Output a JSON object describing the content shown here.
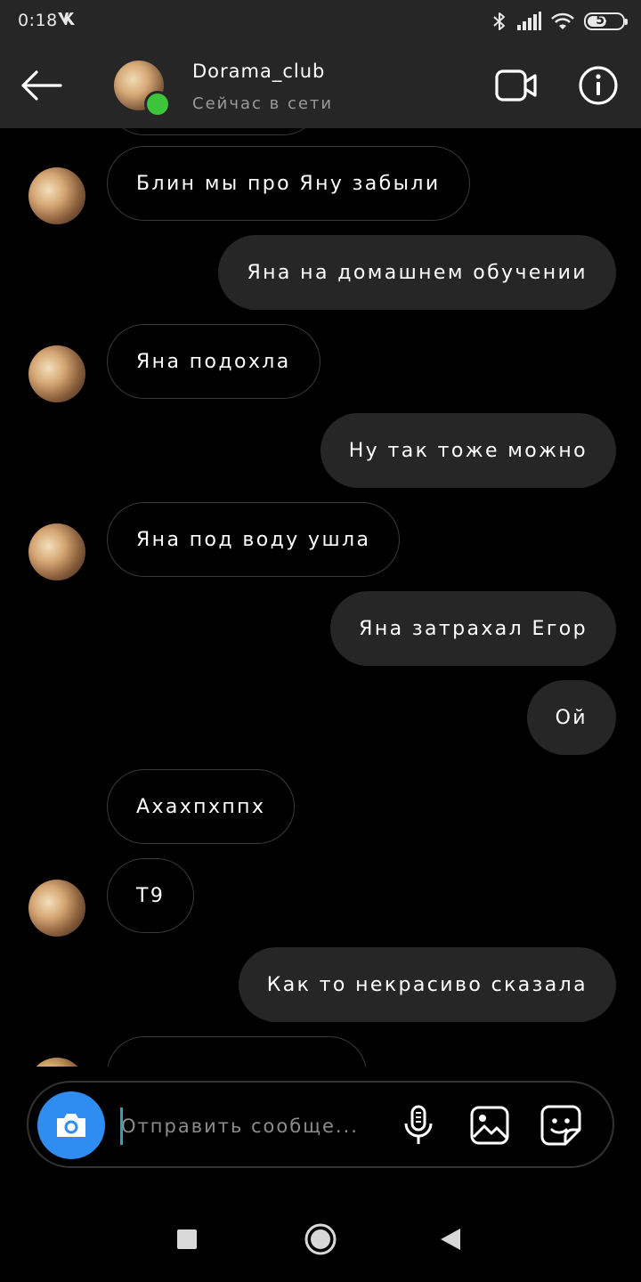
{
  "status_bar": {
    "time": "0:18",
    "vk_label": "vk",
    "battery": "59",
    "battery_level": 0.59,
    "icons": [
      "bluetooth-icon",
      "signal-icon",
      "wifi-icon",
      "battery-icon"
    ]
  },
  "header": {
    "name": "Dorama_club",
    "status": "Сейчас в сети",
    "online_color": "#3cc43a"
  },
  "messages": [
    {
      "side": "in",
      "avatar": true,
      "text": "Блин мы про Яну забыли"
    },
    {
      "side": "out",
      "avatar": false,
      "text": "Яна на домашнем обучении"
    },
    {
      "side": "in",
      "avatar": true,
      "text": "Яна подохла"
    },
    {
      "side": "out",
      "avatar": false,
      "text": "Ну так тоже можно"
    },
    {
      "side": "in",
      "avatar": true,
      "text": "Яна под воду ушла"
    },
    {
      "side": "out",
      "avatar": false,
      "text": "Яна затрахал Егор"
    },
    {
      "side": "out",
      "avatar": false,
      "text": "Ой"
    },
    {
      "side": "in",
      "avatar": false,
      "text": "Ахахпхппх"
    },
    {
      "side": "in",
      "avatar": true,
      "text": "Т9"
    },
    {
      "side": "out",
      "avatar": false,
      "text": "Как то некрасиво сказала"
    }
  ],
  "composer": {
    "placeholder": "Отправить сообще...",
    "camera_color": "#2f8df2"
  },
  "colors": {
    "background": "#000000",
    "bar": "#262626",
    "outgoing_bubble": "#262626"
  }
}
